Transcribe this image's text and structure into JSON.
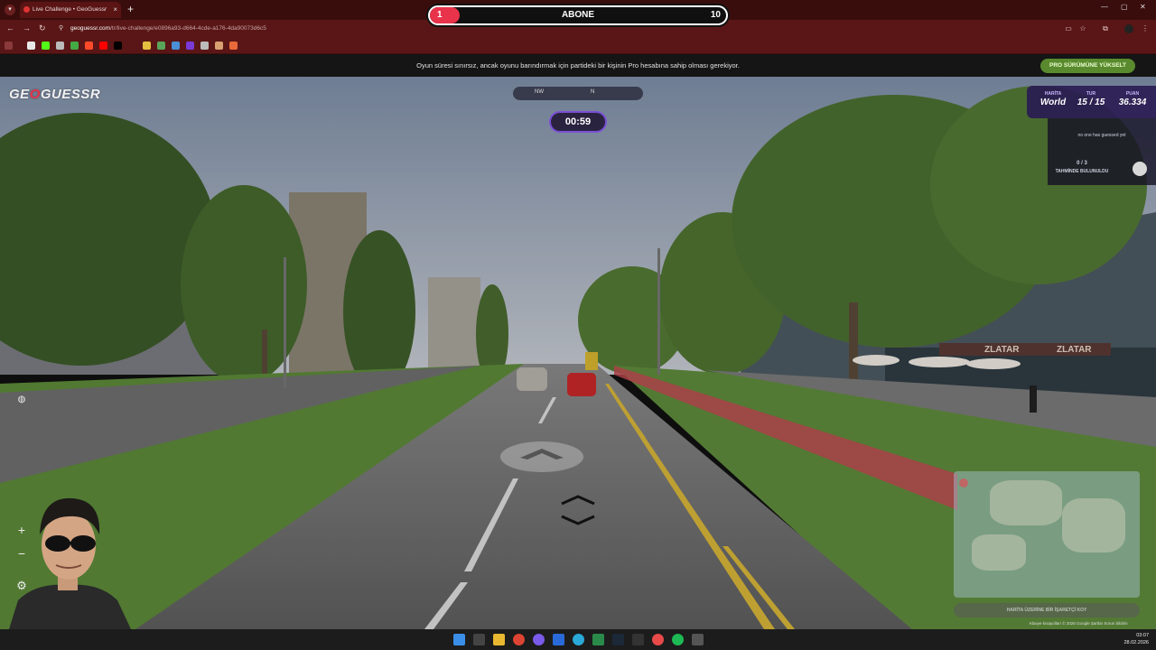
{
  "browser": {
    "tab_title": "Live Challenge • GeoGuessr",
    "new_tab_label": "+",
    "url_host": "geoguessr.com",
    "url_path": "/tr/live-challenge/e0896a93-d664-4cde-a176-4da90073d6c5"
  },
  "stream_overlay": {
    "goal_label": "ABONE",
    "current": "1",
    "target": "10",
    "progress_fraction": 0.1
  },
  "banner": {
    "message": "Oyun süresi sınırsız, ancak oyunu barındırmak için partideki bir kişinin Pro hesabına sahip olması gerekiyor.",
    "pro_button": "PRO SÜRÜMÜNE YÜKSELT"
  },
  "game": {
    "logo_prefix": "GE",
    "logo_o": "O",
    "logo_suffix": "GUESSR",
    "compass": {
      "left": "NW",
      "center": "N"
    },
    "timer": "00:59",
    "hud": {
      "map_label": "HARİTA",
      "map_value": "World",
      "round_label": "TUR",
      "round_value": "15 / 15",
      "score_label": "PUAN",
      "score_value": "36.334"
    },
    "guess_panel": {
      "no_guess": "no one has guessed yet",
      "count": "0 / 3",
      "found_label": "TAHMİNDE BULUNULDU"
    },
    "map_guess_button": "HARİTA ÜZERİNE BİR İŞARETÇİ KOY",
    "attribution": "Klavye kısayolları  © 2026 Google  Şartlar  Sorun bildirin"
  },
  "taskbar": {
    "time": "03:07",
    "date": "28.02.2026"
  }
}
